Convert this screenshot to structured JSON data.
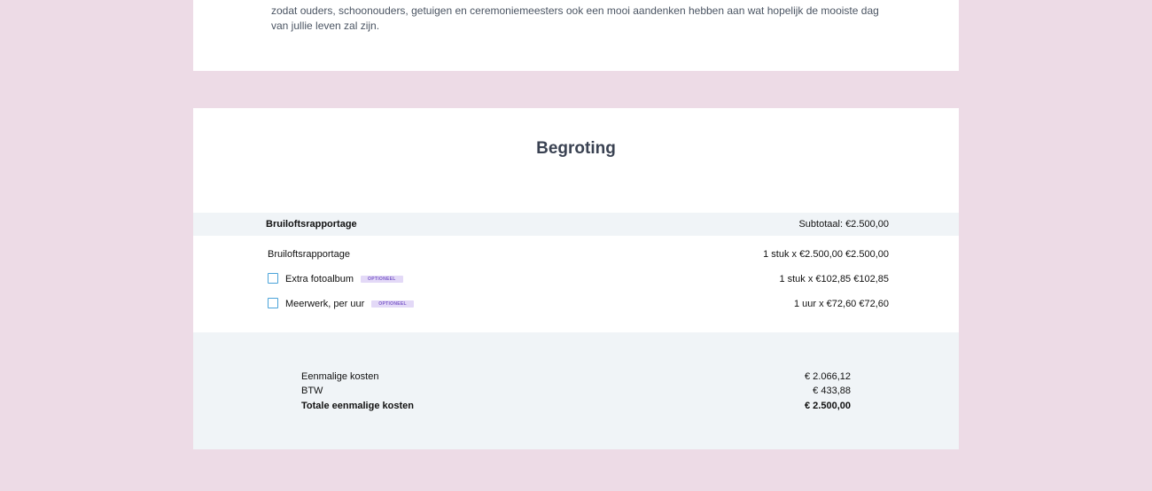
{
  "intro": {
    "lines": [
      "zodat ouders, schoonouders, getuigen en ceremoniemeesters ook een mooi aandenken hebben aan wat hopelijk de mooiste dag",
      "van jullie leven zal zijn."
    ]
  },
  "budget": {
    "title": "Begroting",
    "section": {
      "name": "Bruiloftsrapportage",
      "subtotal": "Subtotaal: €2.500,00"
    },
    "items": [
      {
        "label": "Bruiloftsrapportage",
        "amount": "1 stuk x €2.500,00   €2.500,00"
      },
      {
        "label": "Extra fotoalbum",
        "badge": "OPTIONEEL",
        "amount": "1 stuk x €102,85   €102,85"
      },
      {
        "label": "Meerwerk, per uur",
        "badge": "OPTIONEEL",
        "amount": "1 uur x €72,60   €72,60"
      }
    ],
    "summary": {
      "one_time_label": "Eenmalige kosten",
      "one_time_value": "€ 2.066,12",
      "vat_label": "BTW",
      "vat_value": "€ 433,88",
      "total_label": "Totale eenmalige kosten",
      "total_value": "€ 2.500,00"
    }
  },
  "colors": {
    "page_background": "#eddbe6",
    "section_background": "#f0f4f7",
    "badge_background": "#e3d9f7",
    "badge_text": "#7c5bc9",
    "checkbox_border": "#4aa3d9"
  }
}
